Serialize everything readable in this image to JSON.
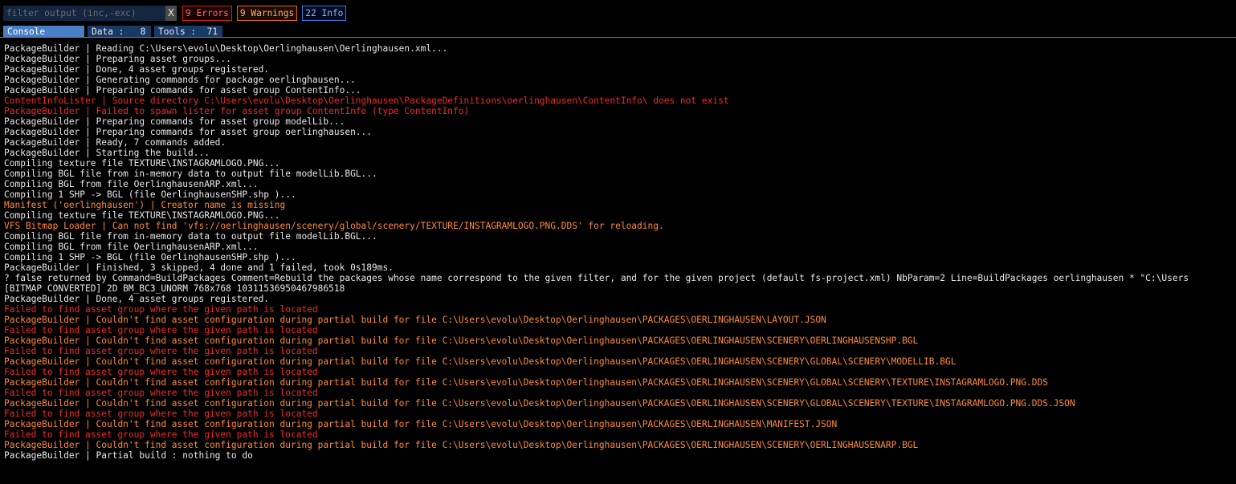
{
  "filter": {
    "placeholder": "filter output (inc,-exc)",
    "value": "",
    "clear_label": "X"
  },
  "badges": {
    "errors": "9 Errors",
    "warnings": "9 Warnings",
    "info": "22 Info"
  },
  "tabs": [
    {
      "label": "Console"
    },
    {
      "label": "Data :   8"
    },
    {
      "label": "Tools :  71"
    }
  ],
  "colors": {
    "error": "#f02a2a",
    "warning": "#ff8a3a",
    "info": "#e8e8e8",
    "accent": "#4a7fc4"
  },
  "log": [
    {
      "level": "info",
      "text": "PackageBuilder | Reading C:\\Users\\evolu\\Desktop\\Oerlinghausen\\Oerlinghausen.xml..."
    },
    {
      "level": "info",
      "text": "PackageBuilder | Preparing asset groups..."
    },
    {
      "level": "info",
      "text": "PackageBuilder | Done, 4 asset groups registered."
    },
    {
      "level": "info",
      "text": "PackageBuilder | Generating commands for package oerlinghausen..."
    },
    {
      "level": "info",
      "text": "PackageBuilder | Preparing commands for asset group ContentInfo..."
    },
    {
      "level": "error",
      "text": "ContentInfoLister | Source directory C:\\Users\\evolu\\Desktop\\Oerlinghausen\\PackageDefinitions\\oerlinghausen\\ContentInfo\\ does not exist"
    },
    {
      "level": "error",
      "text": "PackageBuilder | Failed to spawn lister for asset group ContentInfo (type ContentInfo)"
    },
    {
      "level": "info",
      "text": "PackageBuilder | Preparing commands for asset group modelLib..."
    },
    {
      "level": "info",
      "text": "PackageBuilder | Preparing commands for asset group oerlinghausen..."
    },
    {
      "level": "info",
      "text": "PackageBuilder | Ready, 7 commands added."
    },
    {
      "level": "info",
      "text": "PackageBuilder | Starting the build..."
    },
    {
      "level": "info",
      "text": "Compiling texture file TEXTURE\\INSTAGRAMLOGO.PNG..."
    },
    {
      "level": "info",
      "text": "Compiling BGL file from in-memory data to output file modelLib.BGL..."
    },
    {
      "level": "info",
      "text": "Compiling BGL from file OerlinghausenARP.xml..."
    },
    {
      "level": "info",
      "text": "Compiling 1 SHP -> BGL (file OerlinghausenSHP.shp )..."
    },
    {
      "level": "warn",
      "text": "Manifest ('oerlinghausen') | Creator name is missing"
    },
    {
      "level": "info",
      "text": "Compiling texture file TEXTURE\\INSTAGRAMLOGO.PNG..."
    },
    {
      "level": "warn",
      "text": "VFS Bitmap Loader | Can not find 'vfs://oerlinghausen/scenery/global/scenery/TEXTURE/INSTAGRAMLOGO.PNG.DDS' for reloading."
    },
    {
      "level": "info",
      "text": "Compiling BGL file from in-memory data to output file modelLib.BGL..."
    },
    {
      "level": "info",
      "text": "Compiling BGL from file OerlinghausenARP.xml..."
    },
    {
      "level": "info",
      "text": "Compiling 1 SHP -> BGL (file OerlinghausenSHP.shp )..."
    },
    {
      "level": "info",
      "text": "PackageBuilder | Finished, 3 skipped, 4 done and 1 failed, took 0s189ms."
    },
    {
      "level": "info",
      "text": "? false returned by Command=BuildPackages Comment=Rebuild the packages whose name correspond to the given filter, and for the given project (default fs-project.xml) NbParam=2 Line=BuildPackages oerlinghausen * \"C:\\Users"
    },
    {
      "level": "info",
      "text": "[BITMAP CONVERTED] 2D BM_BC3_UNORM 768x768 10311536950467986518"
    },
    {
      "level": "info",
      "text": "PackageBuilder | Done, 4 asset groups registered."
    },
    {
      "level": "error",
      "text": "Failed to find asset group where the given path is located"
    },
    {
      "level": "warn",
      "text": "PackageBuilder | Couldn't find asset configuration during partial build for file C:\\Users\\evolu\\Desktop\\Oerlinghausen\\PACKAGES\\OERLINGHAUSEN\\LAYOUT.JSON"
    },
    {
      "level": "error",
      "text": "Failed to find asset group where the given path is located"
    },
    {
      "level": "warn",
      "text": "PackageBuilder | Couldn't find asset configuration during partial build for file C:\\Users\\evolu\\Desktop\\Oerlinghausen\\PACKAGES\\OERLINGHAUSEN\\SCENERY\\OERLINGHAUSENSHP.BGL"
    },
    {
      "level": "error",
      "text": "Failed to find asset group where the given path is located"
    },
    {
      "level": "warn",
      "text": "PackageBuilder | Couldn't find asset configuration during partial build for file C:\\Users\\evolu\\Desktop\\Oerlinghausen\\PACKAGES\\OERLINGHAUSEN\\SCENERY\\GLOBAL\\SCENERY\\MODELLIB.BGL"
    },
    {
      "level": "error",
      "text": "Failed to find asset group where the given path is located"
    },
    {
      "level": "warn",
      "text": "PackageBuilder | Couldn't find asset configuration during partial build for file C:\\Users\\evolu\\Desktop\\Oerlinghausen\\PACKAGES\\OERLINGHAUSEN\\SCENERY\\GLOBAL\\SCENERY\\TEXTURE\\INSTAGRAMLOGO.PNG.DDS"
    },
    {
      "level": "error",
      "text": "Failed to find asset group where the given path is located"
    },
    {
      "level": "warn",
      "text": "PackageBuilder | Couldn't find asset configuration during partial build for file C:\\Users\\evolu\\Desktop\\Oerlinghausen\\PACKAGES\\OERLINGHAUSEN\\SCENERY\\GLOBAL\\SCENERY\\TEXTURE\\INSTAGRAMLOGO.PNG.DDS.JSON"
    },
    {
      "level": "error",
      "text": "Failed to find asset group where the given path is located"
    },
    {
      "level": "warn",
      "text": "PackageBuilder | Couldn't find asset configuration during partial build for file C:\\Users\\evolu\\Desktop\\Oerlinghausen\\PACKAGES\\OERLINGHAUSEN\\MANIFEST.JSON"
    },
    {
      "level": "error",
      "text": "Failed to find asset group where the given path is located"
    },
    {
      "level": "warn",
      "text": "PackageBuilder | Couldn't find asset configuration during partial build for file C:\\Users\\evolu\\Desktop\\Oerlinghausen\\PACKAGES\\OERLINGHAUSEN\\SCENERY\\OERLINGHAUSENARP.BGL"
    },
    {
      "level": "info",
      "text": "PackageBuilder | Partial build : nothing to do"
    }
  ]
}
